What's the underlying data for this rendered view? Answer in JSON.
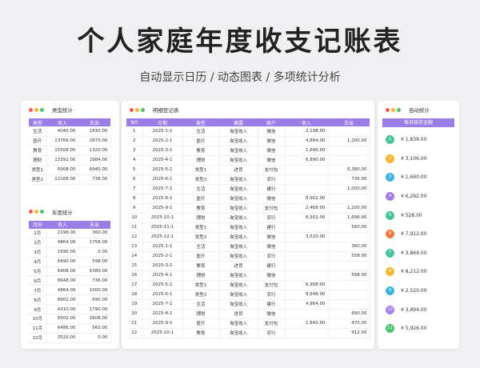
{
  "title": "个人家庭年度收支记账表",
  "subtitle": "自动显示日历 / 动态图表 / 多项统计分析",
  "colors": {
    "accent": "#9a7de6",
    "dot_red": "#f05b5b",
    "dot_yellow": "#f5b731",
    "dot_green": "#4bc26b"
  },
  "type_stats": {
    "title": "类型统计",
    "headers": [
      "类型",
      "收入",
      "支出"
    ],
    "rows": [
      [
        "生活",
        "4040.00",
        "1830.00"
      ],
      [
        "医疗",
        "13766.00",
        "2670.00"
      ],
      [
        "教育",
        "15508.00",
        "1320.00"
      ],
      [
        "理财",
        "13392.00",
        "2984.00"
      ],
      [
        "类型1",
        "6908.00",
        "6940.00"
      ],
      [
        "类型2",
        "12168.00",
        "736.00"
      ]
    ]
  },
  "month_stats": {
    "title": "年度统计",
    "headers": [
      "月份",
      "收入",
      "支出"
    ],
    "rows": [
      [
        "1月",
        "2198.00",
        "360.00"
      ],
      [
        "2月",
        "4864.00",
        "1758.00"
      ],
      [
        "3月",
        "1690.00",
        "0.00"
      ],
      [
        "4月",
        "6890.00",
        "598.00"
      ],
      [
        "5月",
        "6908.00",
        "6380.00"
      ],
      [
        "6月",
        "8648.00",
        "736.00"
      ],
      [
        "7月",
        "4864.00",
        "1000.00"
      ],
      [
        "8月",
        "8902.00",
        "690.00"
      ],
      [
        "9月",
        "4310.00",
        "1790.00"
      ],
      [
        "10月",
        "6502.00",
        "2608.00"
      ],
      [
        "11月",
        "6486.00",
        "560.00"
      ],
      [
        "12月",
        "3520.00",
        "0.00"
      ]
    ]
  },
  "ledger": {
    "title": "明细登记表",
    "headers": [
      "NO",
      "日期",
      "类型",
      "摘要",
      "账户",
      "收入",
      "支出"
    ],
    "rows": [
      [
        "1",
        "2025-1-1",
        "生活",
        "淘宝收入",
        "微信",
        "2,198.00",
        ""
      ],
      [
        "2",
        "2025-2-1",
        "医疗",
        "淘宝收入",
        "微信",
        "4,864.00",
        "1,200.00"
      ],
      [
        "3",
        "2025-3-1",
        "教育",
        "淘宝收入",
        "微信",
        "1,690.00",
        ""
      ],
      [
        "4",
        "2025-4-1",
        "理财",
        "淘宝收入",
        "微信",
        "6,890.00",
        ""
      ],
      [
        "5",
        "2025-5-1",
        "类型1",
        "进货",
        "支付包",
        "",
        "6,380.00"
      ],
      [
        "6",
        "2025-6-1",
        "类型2",
        "淘宝收入",
        "农行",
        "",
        "736.00"
      ],
      [
        "7",
        "2025-7-1",
        "生活",
        "淘宝收入",
        "建行",
        "",
        "1,000.00"
      ],
      [
        "8",
        "2025-8-1",
        "医疗",
        "淘宝收入",
        "微信",
        "8,902.00",
        ""
      ],
      [
        "9",
        "2025-9-1",
        "教育",
        "淘宝收入",
        "支付包",
        "2,468.00",
        "1,200.00"
      ],
      [
        "10",
        "2025-10-1",
        "理财",
        "淘宝收入",
        "农行",
        "6,502.00",
        "1,696.00"
      ],
      [
        "11",
        "2025-11-1",
        "类型1",
        "淘宝收入",
        "建行",
        "",
        "560.00"
      ],
      [
        "12",
        "2025-12-1",
        "类型2",
        "淘宝收入",
        "微信",
        "3,520.00",
        ""
      ],
      [
        "13",
        "2025-1-1",
        "生活",
        "淘宝收入",
        "微信",
        "",
        "360.00"
      ],
      [
        "14",
        "2025-2-1",
        "医疗",
        "淘宝收入",
        "农行",
        "",
        "558.00"
      ],
      [
        "15",
        "2025-3-1",
        "教育",
        "进货",
        "建行",
        "",
        ""
      ],
      [
        "16",
        "2025-4-1",
        "理财",
        "淘宝收入",
        "微信",
        "",
        "598.00"
      ],
      [
        "17",
        "2025-5-1",
        "类型1",
        "淘宝收入",
        "支付包",
        "6,908.00",
        ""
      ],
      [
        "18",
        "2025-6-1",
        "类型2",
        "淘宝收入",
        "农行",
        "8,648.00",
        ""
      ],
      [
        "19",
        "2025-7-1",
        "生活",
        "淘宝收入",
        "建行",
        "4,864.00",
        ""
      ],
      [
        "20",
        "2025-8-1",
        "理财",
        "进货",
        "微信",
        "",
        "690.00"
      ],
      [
        "21",
        "2025-9-1",
        "医疗",
        "淘宝收入",
        "支付包",
        "1,842.00",
        "470.00"
      ],
      [
        "22",
        "2025-10-1",
        "教育",
        "淘宝收入",
        "农行",
        "",
        "912.00"
      ]
    ]
  },
  "auto_stats": {
    "title": "自动统计",
    "header": "每月结存金额",
    "items": [
      {
        "n": "1",
        "value": "¥ 1,838.00",
        "color": "#4bc29e"
      },
      {
        "n": "2",
        "value": "¥ 3,106.00",
        "color": "#f5b731"
      },
      {
        "n": "3",
        "value": "¥ 1,690.00",
        "color": "#3bb4e0"
      },
      {
        "n": "4",
        "value": "¥ 6,292.00",
        "color": "#a77de6"
      },
      {
        "n": "5",
        "value": "¥ 528.00",
        "color": "#4bc29e"
      },
      {
        "n": "6",
        "value": "¥ 7,912.00",
        "color": "#f07a3a"
      },
      {
        "n": "7",
        "value": "¥ 3,864.00",
        "color": "#4bc29e"
      },
      {
        "n": "8",
        "value": "¥ 8,212.00",
        "color": "#f5b731"
      },
      {
        "n": "9",
        "value": "¥ 2,520.00",
        "color": "#3bb4e0"
      },
      {
        "n": "10",
        "value": "¥ 3,894.00",
        "color": "#a77de6"
      },
      {
        "n": "11",
        "value": "¥ 5,926.00",
        "color": "#4bc26b"
      }
    ]
  }
}
